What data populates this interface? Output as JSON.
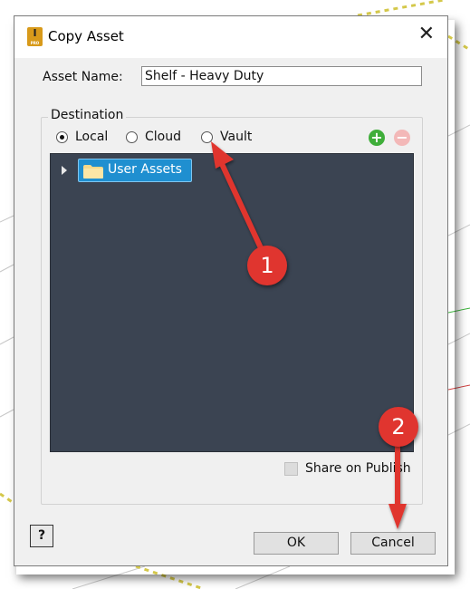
{
  "dialog": {
    "title": "Copy Asset",
    "app_icon_letter": "I",
    "app_icon_sublabel": "PRO",
    "close_icon": "close-icon",
    "asset_name_label": "Asset Name:",
    "asset_name_value": "Shelf - Heavy Duty",
    "destination_label": "Destination",
    "radios": [
      {
        "label": "Local",
        "selected": true
      },
      {
        "label": "Cloud",
        "selected": false
      },
      {
        "label": "Vault",
        "selected": false
      }
    ],
    "add_icon": "+",
    "remove_icon": "−",
    "tree": {
      "items": [
        {
          "label": "User Assets",
          "icon": "folder-icon",
          "selected": true
        }
      ]
    },
    "share_on_publish_label": "Share on Publish",
    "share_on_publish_checked": false,
    "help_label": "?",
    "ok_label": "OK",
    "cancel_label": "Cancel"
  },
  "annotations": {
    "badge_1": "1",
    "badge_2": "2",
    "color": "#e0352f"
  }
}
